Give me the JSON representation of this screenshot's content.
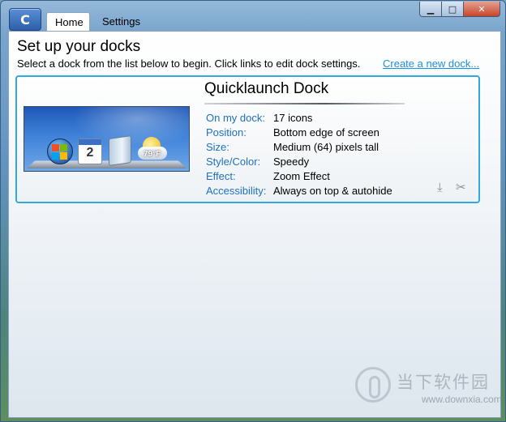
{
  "tabs": [
    {
      "label": "Home",
      "active": true
    },
    {
      "label": "Settings",
      "active": false
    }
  ],
  "main": {
    "title": "Set up your docks",
    "subtitle": "Select a dock from the list below to begin. Click links to edit dock settings.",
    "create_link": "Create a new dock..."
  },
  "dock": {
    "name": "Quicklaunch Dock",
    "preview": {
      "calendar_day": "2",
      "temperature": "79°F"
    },
    "properties": [
      {
        "label": "On my dock:",
        "value": "17 icons"
      },
      {
        "label": "Position:",
        "value": "Bottom edge of screen"
      },
      {
        "label": "Size:",
        "value": "Medium (64) pixels tall"
      },
      {
        "label": "Style/Color:",
        "value": "Speedy"
      },
      {
        "label": "Effect:",
        "value": "Zoom Effect"
      },
      {
        "label": "Accessibility:",
        "value": "Always on top & autohide"
      }
    ]
  },
  "watermark": {
    "site_cn": "当下软件园",
    "url": "www.downxia.com"
  },
  "icons": {
    "app": "objectdock-icon",
    "export": "download-arrow-icon",
    "remove": "remove-tools-icon"
  },
  "colors": {
    "accent": "#33a8e0",
    "link": "#1e90e0",
    "label": "#1e70c0"
  }
}
